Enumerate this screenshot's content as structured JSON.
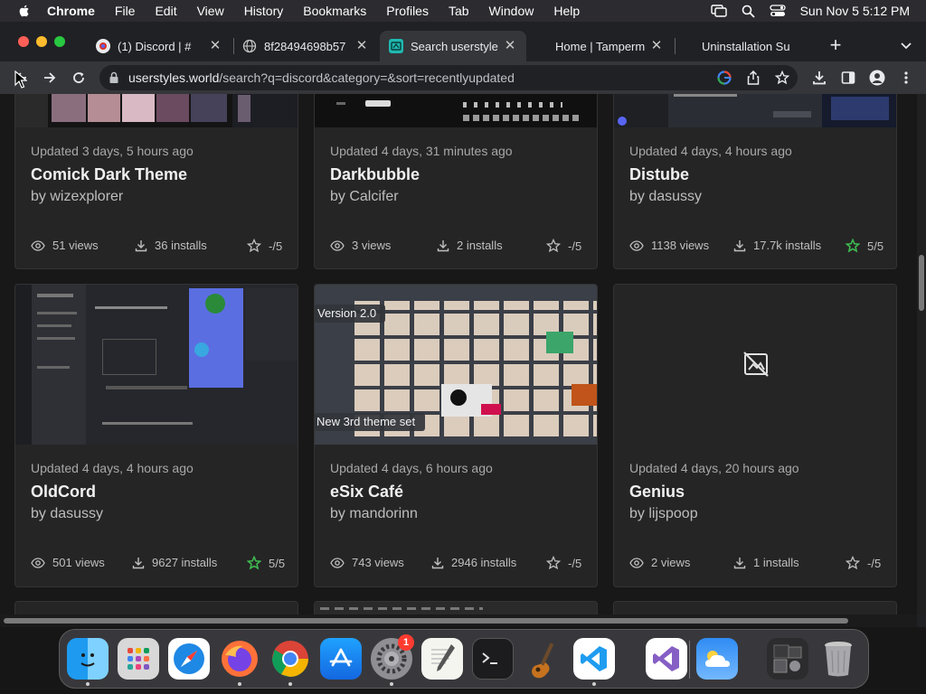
{
  "menubar": {
    "app": "Chrome",
    "items": [
      "File",
      "Edit",
      "View",
      "History",
      "Bookmarks",
      "Profiles",
      "Tab",
      "Window",
      "Help"
    ],
    "datetime": "Sun Nov 5  5:12 PM"
  },
  "tabs": [
    {
      "title": "(1) Discord | #",
      "favicon": "discord-icon",
      "active": false
    },
    {
      "title": "8f28494698b57",
      "favicon": "globe-icon",
      "active": false
    },
    {
      "title": "Search userstyle",
      "favicon": "userstyles-icon",
      "active": true
    },
    {
      "title": "Home | Tamperm",
      "favicon": "tampermonkey-icon",
      "active": false
    },
    {
      "title": "Uninstallation Su",
      "favicon": "page-icon",
      "active": false
    }
  ],
  "toolbar": {
    "url_host": "userstyles.world",
    "url_path": "/search?q=discord&category=&sort=recentlyupdated"
  },
  "cards": [
    {
      "updated": "Updated 3 days, 5 hours ago",
      "name": "Comick Dark Theme",
      "author": "by wizexplorer",
      "views": "51 views",
      "installs": "36 installs",
      "rating": "-/5",
      "rated": false
    },
    {
      "updated": "Updated 4 days, 31 minutes ago",
      "name": "Darkbubble",
      "author": "by Calcifer",
      "views": "3 views",
      "installs": "2 installs",
      "rating": "-/5",
      "rated": false
    },
    {
      "updated": "Updated 4 days, 4 hours ago",
      "name": "Distube",
      "author": "by dasussy",
      "views": "1138 views",
      "installs": "17.7k installs",
      "rating": "5/5",
      "rated": true
    },
    {
      "updated": "Updated 4 days, 4 hours ago",
      "name": "OldCord",
      "author": "by dasussy",
      "views": "501 views",
      "installs": "9627 installs",
      "rating": "5/5",
      "rated": true
    },
    {
      "updated": "Updated 4 days, 6 hours ago",
      "name": "eSix Café",
      "author": "by mandorinn",
      "views": "743 views",
      "installs": "2946 installs",
      "rating": "-/5",
      "rated": false,
      "thumb_top_label": "Version 2.0",
      "thumb_bottom_label": "New 3rd theme set"
    },
    {
      "updated": "Updated 4 days, 20 hours ago",
      "name": "Genius",
      "author": "by lijspoop",
      "views": "2 views",
      "installs": "1 installs",
      "rating": "-/5",
      "rated": false
    }
  ],
  "dock": {
    "badge": "1",
    "apps": [
      "finder-icon",
      "launchpad-icon",
      "safari-icon",
      "firefox-icon",
      "chrome-icon",
      "app-store-icon",
      "system-settings-icon",
      "textedit-icon",
      "terminal-icon",
      "garageband-icon",
      "vscode-icon",
      "visual-studio-icon",
      "weather-icon",
      "stacks-icon",
      "trash-icon"
    ]
  },
  "colors": {
    "accent_green": "#3fb950",
    "discord_purple": "#5865f2",
    "chrome_dark": "#202124"
  }
}
